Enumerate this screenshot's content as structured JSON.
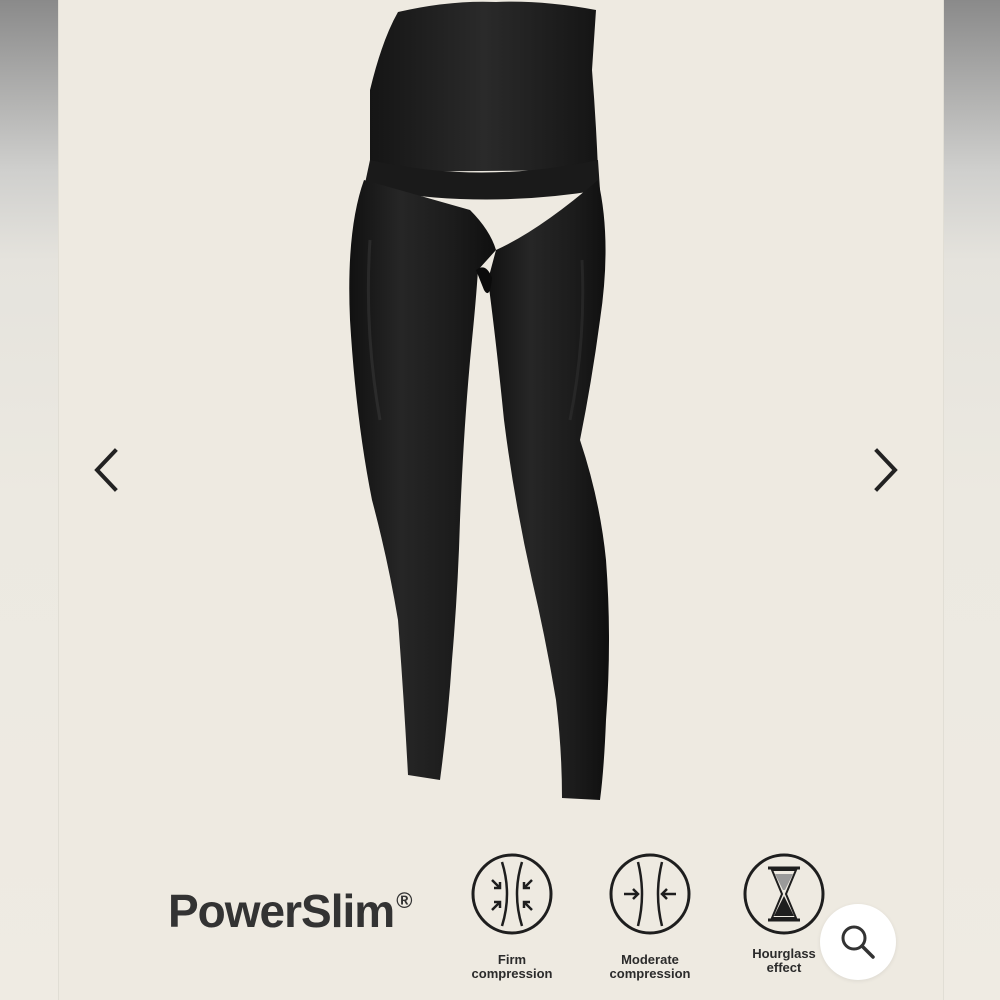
{
  "carousel": {
    "image_alt": "PowerSlim high-waist shaping leggings",
    "prev_icon": "chevron-left-icon",
    "next_icon": "chevron-right-icon"
  },
  "brand": {
    "name": "PowerSlim",
    "mark": "®"
  },
  "features": [
    {
      "icon": "firm-compression-icon",
      "label": "Firm\ncompression"
    },
    {
      "icon": "moderate-compression-icon",
      "label": "Moderate\ncompression"
    },
    {
      "icon": "hourglass-icon",
      "label": "Hourglass\neffect"
    }
  ],
  "zoom": {
    "icon": "search-icon"
  },
  "colors": {
    "background": "#eeeae1",
    "garment": "#1f1f1f",
    "text": "#333333"
  }
}
